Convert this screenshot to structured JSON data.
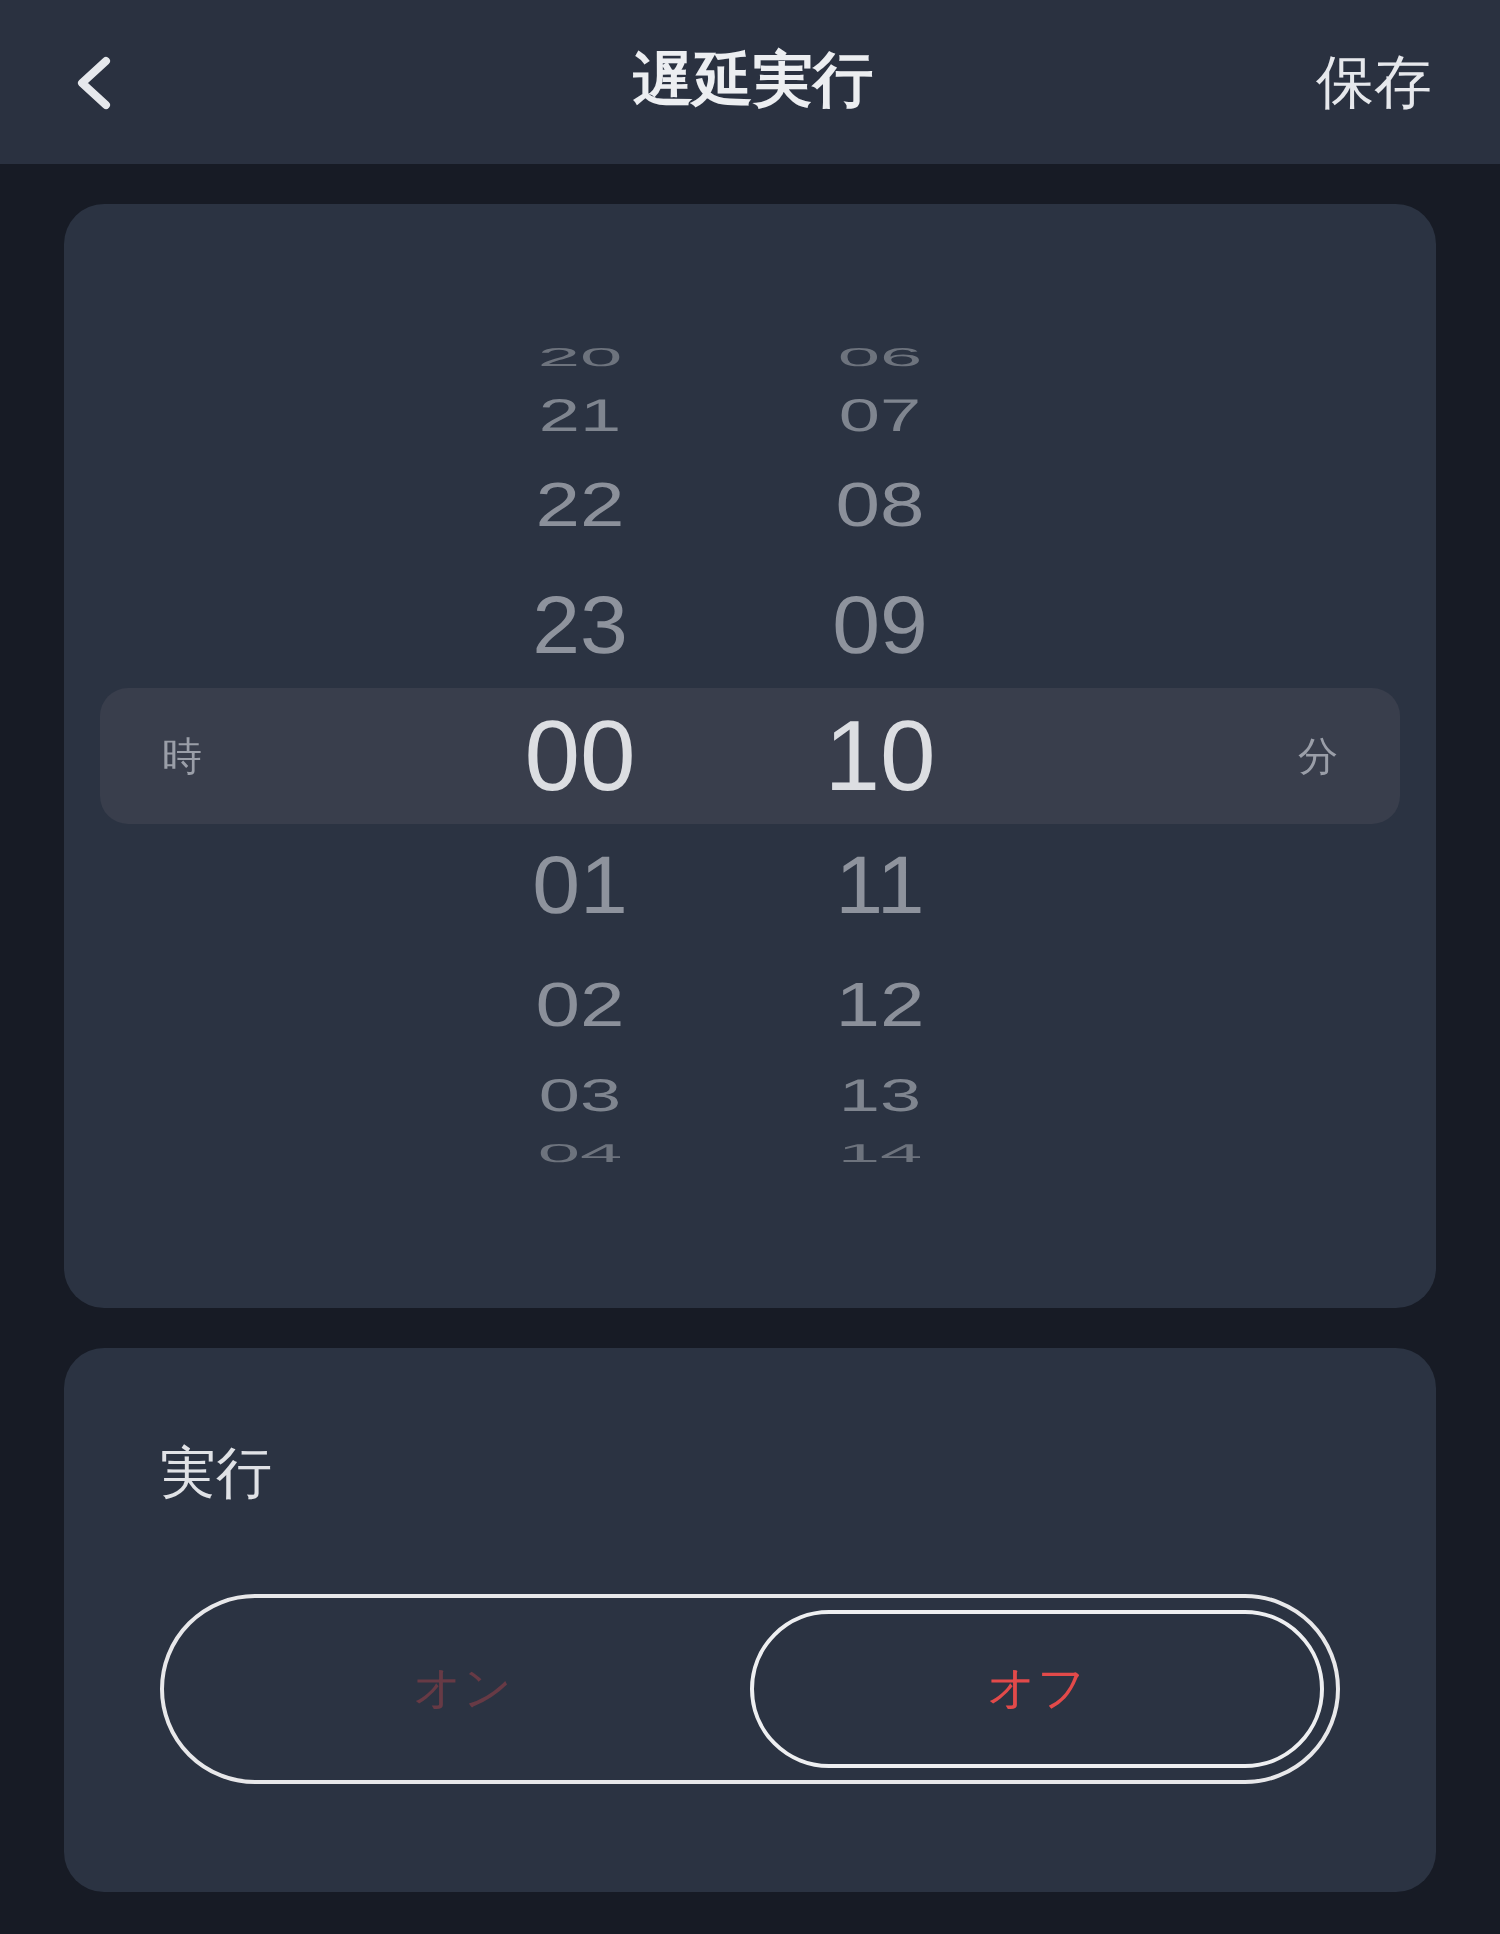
{
  "header": {
    "title": "遅延実行",
    "save": "保存"
  },
  "picker": {
    "hour_unit": "時",
    "minute_unit": "分",
    "columns": [
      {
        "items": [
          {
            "value": "20",
            "selected": false
          },
          {
            "value": "21",
            "selected": false
          },
          {
            "value": "22",
            "selected": false
          },
          {
            "value": "23",
            "selected": false
          },
          {
            "value": "00",
            "selected": true
          },
          {
            "value": "01",
            "selected": false
          },
          {
            "value": "02",
            "selected": false
          },
          {
            "value": "03",
            "selected": false
          },
          {
            "value": "04",
            "selected": false
          }
        ]
      },
      {
        "items": [
          {
            "value": "06",
            "selected": false
          },
          {
            "value": "07",
            "selected": false
          },
          {
            "value": "08",
            "selected": false
          },
          {
            "value": "09",
            "selected": false
          },
          {
            "value": "10",
            "selected": true
          },
          {
            "value": "11",
            "selected": false
          },
          {
            "value": "12",
            "selected": false
          },
          {
            "value": "13",
            "selected": false
          },
          {
            "value": "14",
            "selected": false
          }
        ]
      }
    ]
  },
  "execution": {
    "label": "実行",
    "options": [
      {
        "label": "オン",
        "selected": false
      },
      {
        "label": "オフ",
        "selected": true
      }
    ]
  }
}
